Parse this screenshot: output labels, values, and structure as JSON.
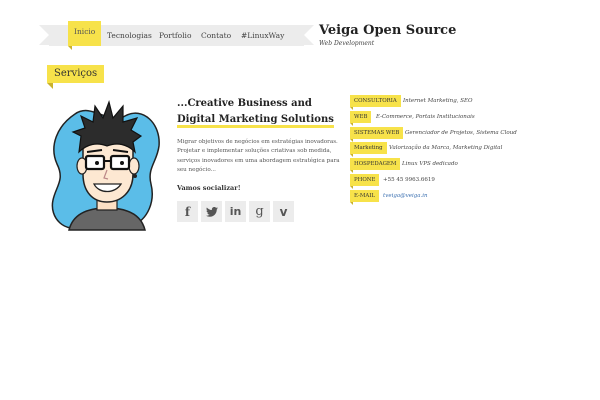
{
  "nav": {
    "items": [
      {
        "label": "Inicio",
        "active": true
      },
      {
        "label": "Tecnologias",
        "active": false
      },
      {
        "label": "Portfolio",
        "active": false
      },
      {
        "label": "Contato",
        "active": false
      },
      {
        "label": "#LinuxWay",
        "active": false
      }
    ]
  },
  "site": {
    "title": "Veiga Open Source",
    "tagline": "Web Development"
  },
  "section": {
    "title": "Serviços"
  },
  "intro": {
    "headline_line1": "...Creative Business and",
    "headline_line2": "Digital Marketing Solutions",
    "description": "Migrar objetivos de negócios em estratégias inovadoras. Projetar e implementar soluções criativas sob medida, serviços inovadores em uma abordagem estratégica para seu negócio...",
    "social_label": "Vamos socializar!"
  },
  "social": [
    {
      "name": "facebook",
      "glyph": "f"
    },
    {
      "name": "twitter",
      "glyph": "t"
    },
    {
      "name": "linkedin",
      "glyph": "in"
    },
    {
      "name": "google-plus",
      "glyph": "g"
    },
    {
      "name": "vimeo",
      "glyph": "v"
    }
  ],
  "services": [
    {
      "label": "CONSULTORIA",
      "value": "Internet Marketing, SEO"
    },
    {
      "label": "WEB",
      "value": "E-Commerce, Portais Institucionais"
    },
    {
      "label": "SISTEMAS WEB",
      "value": "Gerenciador de Projetos, Sistema Cloud"
    },
    {
      "label": "Marketing",
      "value": "Valorização da Marca, Marketing Digital"
    },
    {
      "label": "HOSPEDAGEM",
      "value": "Linux VPS dedicado"
    },
    {
      "label": "PHONE",
      "value": "+55 45 9963.6619"
    },
    {
      "label": "E-MAIL",
      "value": "tveiga@veiga.in"
    }
  ],
  "colors": {
    "accent": "#f7e24a",
    "accent_dark": "#c9b22d",
    "ribbon": "#ececec",
    "link": "#3a6fb0",
    "avatar_blob": "#5bbde8"
  }
}
